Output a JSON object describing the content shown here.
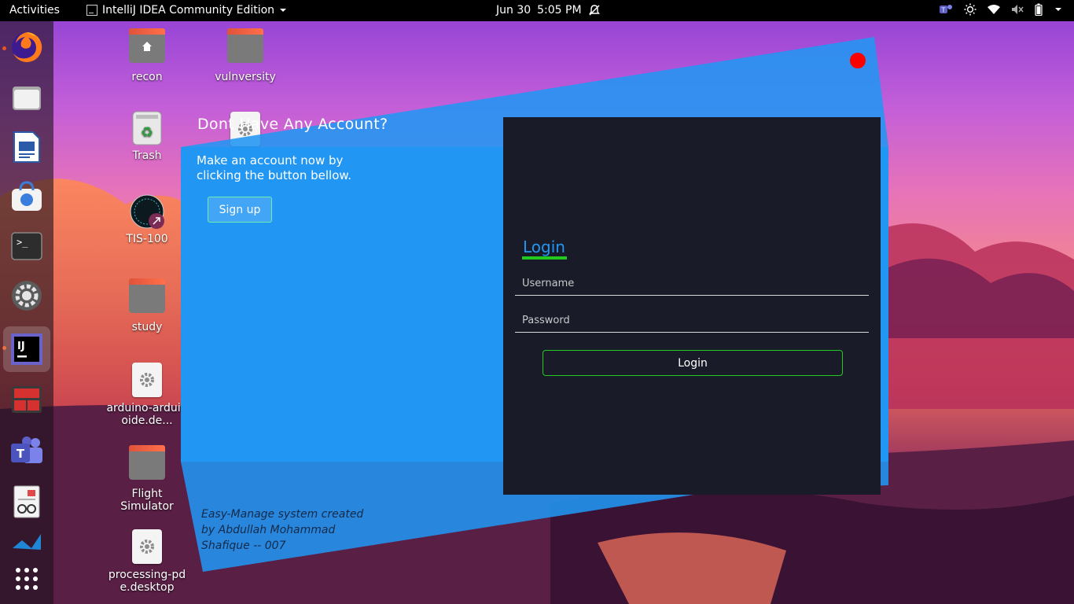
{
  "topbar": {
    "activities": "Activities",
    "app_name": "IntelliJ IDEA Community Edition",
    "date": "Jun 30",
    "time": "5:05 PM",
    "tray_icons": [
      "teams-tray-icon",
      "brightness-icon",
      "wifi-icon",
      "volume-muted-icon",
      "battery-icon",
      "power-menu-icon"
    ]
  },
  "dock": {
    "items": [
      "firefox",
      "files",
      "libreoffice-impress",
      "software-center",
      "terminal",
      "settings",
      "intellij-idea",
      "terminal-multiplexer",
      "microsoft-teams",
      "document-viewer",
      "visual-studio-code",
      "show-applications"
    ]
  },
  "desktop": {
    "icons": [
      {
        "label": "recon"
      },
      {
        "label": "vulnversity"
      },
      {
        "label": "Trash"
      },
      {
        "label": "TIS-100"
      },
      {
        "label": "study"
      },
      {
        "label": "arduino-arduinoide.de..."
      },
      {
        "label": "Flight Simulator"
      },
      {
        "label": "processing-pde.desktop"
      }
    ]
  },
  "app": {
    "signup": {
      "title": "Dont Have Any Account?",
      "description": "Make an account now by clicking the button bellow.",
      "button": "Sign up"
    },
    "credits": "Easy-Manage system created by Abdullah Mohammad Shafique -- 007",
    "login": {
      "title": "Login",
      "username_placeholder": "Username",
      "password_placeholder": "Password",
      "button": "Login"
    },
    "colors": {
      "panel_blue": "#2196f3",
      "login_bg": "#191b29",
      "accent_green": "#22c91f",
      "close_red": "#ff0000"
    }
  }
}
